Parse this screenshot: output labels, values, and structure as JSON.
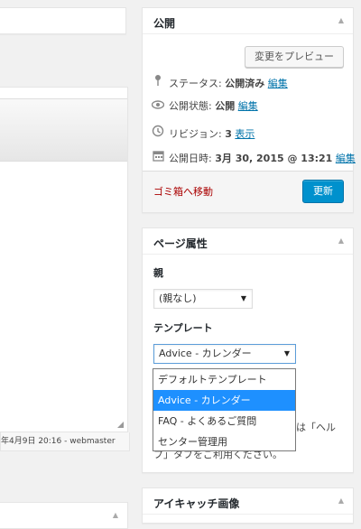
{
  "editor": {
    "last_edited": "年4月9日 20:16 - webmaster"
  },
  "publish": {
    "title": "公開",
    "preview_label": "変更をプレビュー",
    "status_label": "ステータス:",
    "status_value": "公開済み",
    "status_edit": "編集",
    "visibility_label": "公開状態:",
    "visibility_value": "公開",
    "visibility_edit": "編集",
    "revisions_label": "リビジョン:",
    "revisions_value": "3",
    "revisions_link": "表示",
    "date_label": "公開日時:",
    "date_value": "3月 30, 2015 @ 13:21",
    "date_edit": "編集",
    "trash_label": "ゴミ箱へ移動",
    "update_label": "更新"
  },
  "page_attributes": {
    "title": "ページ属性",
    "parent_label": "親",
    "parent_value": "(親なし)",
    "template_label": "テンプレート",
    "template_value": "Advice - カレンダー",
    "template_options": [
      "デフォルトテンプレート",
      "Advice - カレンダー",
      "FAQ - よくあるご質問",
      "センター管理用"
    ],
    "help_fragment_1": "は「ヘル",
    "help_fragment_2": "プ」タブをご利用ください。"
  },
  "eyecatch": {
    "title": "アイキャッチ画像"
  },
  "icons": [
    "pin-icon",
    "eye-icon",
    "history-icon",
    "calendar-icon"
  ],
  "colors": {
    "accent": "#0091cd",
    "link": "#0073aa",
    "trash": "#a00",
    "selected_option": "#1e90ff"
  }
}
